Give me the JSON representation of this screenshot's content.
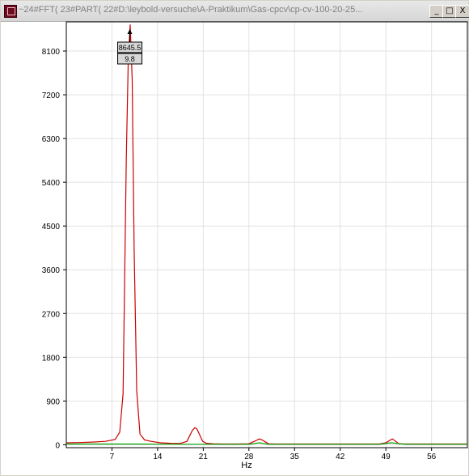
{
  "window": {
    "title": "~24#FFT( 23#PART( 22#D:\\leybold-versuche\\A-Praktikum\\Gas-cpcv\\cp-cv-100-20-25...",
    "minimize_label": "_",
    "maximize_label": "□",
    "close_label": "X"
  },
  "tooltip": {
    "value": "8645.5",
    "x": "9.8"
  },
  "chart_data": {
    "type": "line",
    "xlabel": "Hz",
    "ylabel": "",
    "xlim": [
      0,
      61.5
    ],
    "ylim": [
      -60,
      8700
    ],
    "x_ticks": [
      7,
      14,
      21,
      28,
      35,
      42,
      49,
      56
    ],
    "y_ticks": [
      0,
      900,
      1800,
      2700,
      3600,
      4500,
      5400,
      6300,
      7200,
      8100
    ],
    "grid": true,
    "series": [
      {
        "color": "#cc0000",
        "x": [
          0,
          2,
          4,
          6,
          7.5,
          8.2,
          8.7,
          9.2,
          9.5,
          9.8,
          10.1,
          10.4,
          10.8,
          11.3,
          12,
          13,
          14.5,
          16,
          17.5,
          18.5,
          19.3,
          19.7,
          20,
          20.4,
          20.9,
          21.5,
          22.5,
          24,
          26,
          28,
          29,
          29.6,
          30,
          30.5,
          31,
          32,
          34,
          36,
          38,
          40,
          42,
          44,
          46,
          48,
          49,
          49.6,
          50,
          50.5,
          51,
          52,
          54,
          56,
          58,
          61.5
        ],
        "y": [
          40,
          45,
          55,
          70,
          110,
          260,
          1050,
          5900,
          7900,
          8645,
          7500,
          4000,
          1100,
          220,
          100,
          70,
          40,
          30,
          28,
          70,
          290,
          350,
          330,
          220,
          70,
          30,
          20,
          15,
          15,
          20,
          80,
          120,
          100,
          60,
          20,
          15,
          15,
          15,
          15,
          15,
          15,
          15,
          15,
          15,
          40,
          90,
          120,
          70,
          20,
          15,
          15,
          15,
          15,
          15
        ]
      },
      {
        "color": "#00a000",
        "x": [
          0,
          5,
          10,
          15,
          20,
          28,
          29.6,
          31,
          40,
          48,
          49.8,
          52,
          61.5
        ],
        "y": [
          15,
          15,
          15,
          12,
          10,
          10,
          40,
          10,
          10,
          10,
          40,
          10,
          10
        ]
      }
    ]
  }
}
